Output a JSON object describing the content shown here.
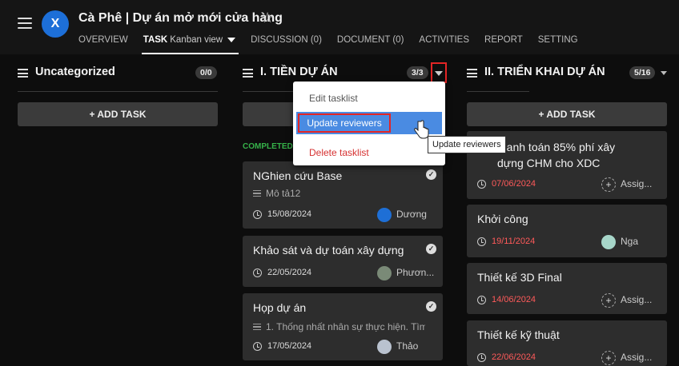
{
  "header": {
    "logo": "X",
    "title": "Cà Phê | Dự án mở mới cửa hàng",
    "tabs": [
      {
        "label": "OVERVIEW"
      },
      {
        "label": "TASK",
        "sub": "Kanban view"
      },
      {
        "label": "DISCUSSION (0)"
      },
      {
        "label": "DOCUMENT (0)"
      },
      {
        "label": "ACTIVITIES"
      },
      {
        "label": "REPORT"
      },
      {
        "label": "SETTING"
      }
    ]
  },
  "columns": [
    {
      "title": "Uncategorized",
      "count": "0/0",
      "add_label": "+ ADD TASK"
    },
    {
      "title": "I. TIỀN DỰ ÁN",
      "count": "3/3",
      "add_label": "+ ADD TASK",
      "completed_label": "COMPLETED",
      "cards": [
        {
          "title": "NGhien cứu Base",
          "desc": "Mô tả12",
          "date": "15/08/2024",
          "assignee": "Dương"
        },
        {
          "title": "Khảo sát và dự toán xây dựng",
          "date": "22/05/2024",
          "assignee": "Phươn..."
        },
        {
          "title": "Họp dự án",
          "desc": "1. Thống nhất nhân sự thực hiện. Tìm...",
          "date": "17/05/2024",
          "assignee": "Thảo"
        }
      ]
    },
    {
      "title": "II. TRIỂN KHAI DỰ ÁN",
      "count": "5/16",
      "add_label": "+ ADD TASK",
      "cards": [
        {
          "title": "thanh toán 85% phí xây dựng CHM cho XDC",
          "title_line1": "thanh toán 85% phí xây",
          "title_line2": "dựng CHM cho XDC",
          "date": "07/06/2024",
          "assignee": "Assig..."
        },
        {
          "title": "Khởi công",
          "date": "19/11/2024",
          "assignee": "Nga"
        },
        {
          "title": "Thiết kế 3D Final",
          "date": "14/06/2024",
          "assignee": "Assig..."
        },
        {
          "title": "Thiết kế kỹ thuật",
          "date": "22/06/2024",
          "assignee": "Assig..."
        }
      ]
    }
  ],
  "menu": {
    "items": [
      "Edit tasklist",
      "Update reviewers",
      "Delete tasklist"
    ]
  },
  "tooltip": "Update reviewers",
  "colors": {
    "accent": "#4a8be2",
    "overdue": "#ff5a5a",
    "completed": "#36b24a",
    "annotation": "#e32525"
  }
}
